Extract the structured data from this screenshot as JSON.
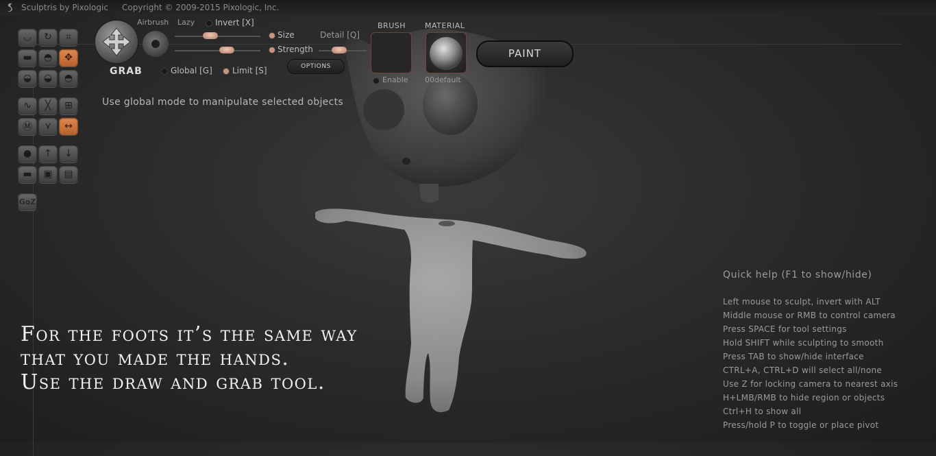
{
  "title_bar": {
    "app_name": "Sculptris by Pixologic",
    "copyright": "Copyright © 2009-2015 Pixologic, Inc."
  },
  "toolbar": {
    "tools_row1": [
      "crease-icon",
      "rotate-icon",
      "scale-icon"
    ],
    "tools_row2": [
      "flatten-icon",
      "inflate-icon",
      "grab-icon"
    ],
    "tools_row3": [
      "draw-icon",
      "pinch-icon",
      "smooth-icon"
    ],
    "tools_row4": [
      "symmetry-icon",
      "mask-icon",
      "grid-icon"
    ],
    "tools_row5": [
      "material-icon",
      "wireframe-icon",
      "move-icon"
    ],
    "tools_row6": [
      "sphere-icon",
      "import-obj-icon",
      "export-obj-icon"
    ],
    "tools_row7": [
      "plane-icon",
      "open-icon",
      "save-icon"
    ],
    "goz_label": "GoZ"
  },
  "tool_options": {
    "current_tool": "GRAB",
    "airbrush": "Airbrush",
    "lazy": "Lazy",
    "invert": "Invert [X]",
    "size": "Size",
    "strength": "Strength",
    "detail": "Detail [Q]",
    "global": "Global [G]",
    "limit": "Limit [S]",
    "options": "OPTIONS"
  },
  "brush": {
    "label": "BRUSH",
    "enable": "Enable"
  },
  "material": {
    "label": "MATERIAL",
    "name": "00default"
  },
  "paint_button": "PAINT",
  "hint_text": "Use global mode to manipulate selected objects",
  "caption": {
    "line1": "For the foots it’s the same way",
    "line2": "that you made the hands.",
    "line3": "Use the draw and grab tool."
  },
  "quick_help": {
    "title": "Quick help (F1 to show/hide)",
    "lines": [
      "Left mouse to sculpt, invert with ALT",
      "Middle mouse or RMB to control camera",
      "Press SPACE for tool settings",
      "Hold SHIFT while sculpting to smooth",
      "Press TAB to show/hide interface",
      "CTRL+A, CTRL+D will select all/none",
      "Use Z for locking camera to nearest axis",
      "H+LMB/RMB to hide region or objects",
      "Ctrl+H to show all",
      "Press/hold P to toggle or place pivot"
    ]
  },
  "colors": {
    "accent": "#d3783e",
    "knob": "#d9a894",
    "panel": "#2b2b2b"
  }
}
